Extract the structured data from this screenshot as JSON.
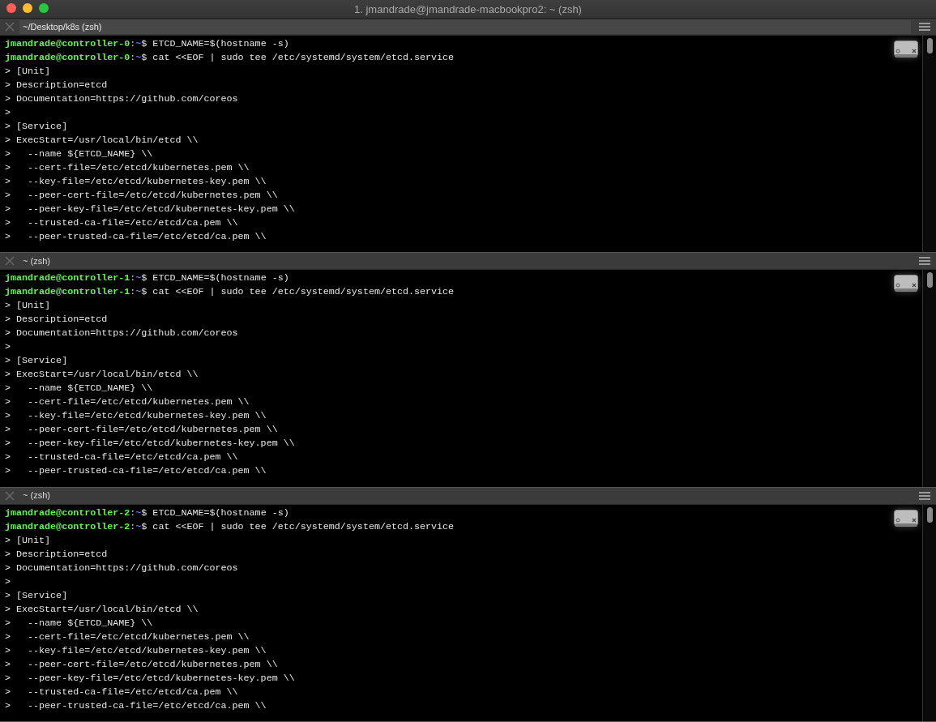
{
  "window": {
    "title": "1. jmandrade@jmandrade-macbookpro2: ~ (zsh)"
  },
  "panes": [
    {
      "title": "~/Desktop/k8s (zsh)",
      "selected": true,
      "lines": [
        {
          "kind": "prompt",
          "user": "jmandrade@controller-0",
          "sep": ":",
          "cwd": "~",
          "command": "$ ETCD_NAME=$(hostname -s)"
        },
        {
          "kind": "prompt",
          "user": "jmandrade@controller-0",
          "sep": ":",
          "cwd": "~",
          "command": "$ cat <<EOF | sudo tee /etc/systemd/system/etcd.service"
        },
        {
          "kind": "output",
          "text": "> [Unit]"
        },
        {
          "kind": "output",
          "text": "> Description=etcd"
        },
        {
          "kind": "output",
          "text": "> Documentation=https://github.com/coreos"
        },
        {
          "kind": "output",
          "text": ">"
        },
        {
          "kind": "output",
          "text": "> [Service]"
        },
        {
          "kind": "output",
          "text": "> ExecStart=/usr/local/bin/etcd \\\\"
        },
        {
          "kind": "output",
          "text": ">   --name ${ETCD_NAME} \\\\"
        },
        {
          "kind": "output",
          "text": ">   --cert-file=/etc/etcd/kubernetes.pem \\\\"
        },
        {
          "kind": "output",
          "text": ">   --key-file=/etc/etcd/kubernetes-key.pem \\\\"
        },
        {
          "kind": "output",
          "text": ">   --peer-cert-file=/etc/etcd/kubernetes.pem \\\\"
        },
        {
          "kind": "output",
          "text": ">   --peer-key-file=/etc/etcd/kubernetes-key.pem \\\\"
        },
        {
          "kind": "output",
          "text": ">   --trusted-ca-file=/etc/etcd/ca.pem \\\\"
        },
        {
          "kind": "output",
          "text": ">   --peer-trusted-ca-file=/etc/etcd/ca.pem \\\\"
        }
      ]
    },
    {
      "title": "~ (zsh)",
      "selected": false,
      "lines": [
        {
          "kind": "prompt",
          "user": "jmandrade@controller-1",
          "sep": ":",
          "cwd": "~",
          "command": "$ ETCD_NAME=$(hostname -s)"
        },
        {
          "kind": "prompt",
          "user": "jmandrade@controller-1",
          "sep": ":",
          "cwd": "~",
          "command": "$ cat <<EOF | sudo tee /etc/systemd/system/etcd.service"
        },
        {
          "kind": "output",
          "text": "> [Unit]"
        },
        {
          "kind": "output",
          "text": "> Description=etcd"
        },
        {
          "kind": "output",
          "text": "> Documentation=https://github.com/coreos"
        },
        {
          "kind": "output",
          "text": ">"
        },
        {
          "kind": "output",
          "text": "> [Service]"
        },
        {
          "kind": "output",
          "text": "> ExecStart=/usr/local/bin/etcd \\\\"
        },
        {
          "kind": "output",
          "text": ">   --name ${ETCD_NAME} \\\\"
        },
        {
          "kind": "output",
          "text": ">   --cert-file=/etc/etcd/kubernetes.pem \\\\"
        },
        {
          "kind": "output",
          "text": ">   --key-file=/etc/etcd/kubernetes-key.pem \\\\"
        },
        {
          "kind": "output",
          "text": ">   --peer-cert-file=/etc/etcd/kubernetes.pem \\\\"
        },
        {
          "kind": "output",
          "text": ">   --peer-key-file=/etc/etcd/kubernetes-key.pem \\\\"
        },
        {
          "kind": "output",
          "text": ">   --trusted-ca-file=/etc/etcd/ca.pem \\\\"
        },
        {
          "kind": "output",
          "text": ">   --peer-trusted-ca-file=/etc/etcd/ca.pem \\\\"
        }
      ]
    },
    {
      "title": "~ (zsh)",
      "selected": false,
      "lines": [
        {
          "kind": "prompt",
          "user": "jmandrade@controller-2",
          "sep": ":",
          "cwd": "~",
          "command": "$ ETCD_NAME=$(hostname -s)"
        },
        {
          "kind": "prompt",
          "user": "jmandrade@controller-2",
          "sep": ":",
          "cwd": "~",
          "command": "$ cat <<EOF | sudo tee /etc/systemd/system/etcd.service"
        },
        {
          "kind": "output",
          "text": "> [Unit]"
        },
        {
          "kind": "output",
          "text": "> Description=etcd"
        },
        {
          "kind": "output",
          "text": "> Documentation=https://github.com/coreos"
        },
        {
          "kind": "output",
          "text": ">"
        },
        {
          "kind": "output",
          "text": "> [Service]"
        },
        {
          "kind": "output",
          "text": "> ExecStart=/usr/local/bin/etcd \\\\"
        },
        {
          "kind": "output",
          "text": ">   --name ${ETCD_NAME} \\\\"
        },
        {
          "kind": "output",
          "text": ">   --cert-file=/etc/etcd/kubernetes.pem \\\\"
        },
        {
          "kind": "output",
          "text": ">   --key-file=/etc/etcd/kubernetes-key.pem \\\\"
        },
        {
          "kind": "output",
          "text": ">   --peer-cert-file=/etc/etcd/kubernetes.pem \\\\"
        },
        {
          "kind": "output",
          "text": ">   --peer-key-file=/etc/etcd/kubernetes-key.pem \\\\"
        },
        {
          "kind": "output",
          "text": ">   --trusted-ca-file=/etc/etcd/ca.pem \\\\"
        },
        {
          "kind": "output",
          "text": ">   --peer-trusted-ca-file=/etc/etcd/ca.pem \\\\"
        }
      ]
    }
  ]
}
